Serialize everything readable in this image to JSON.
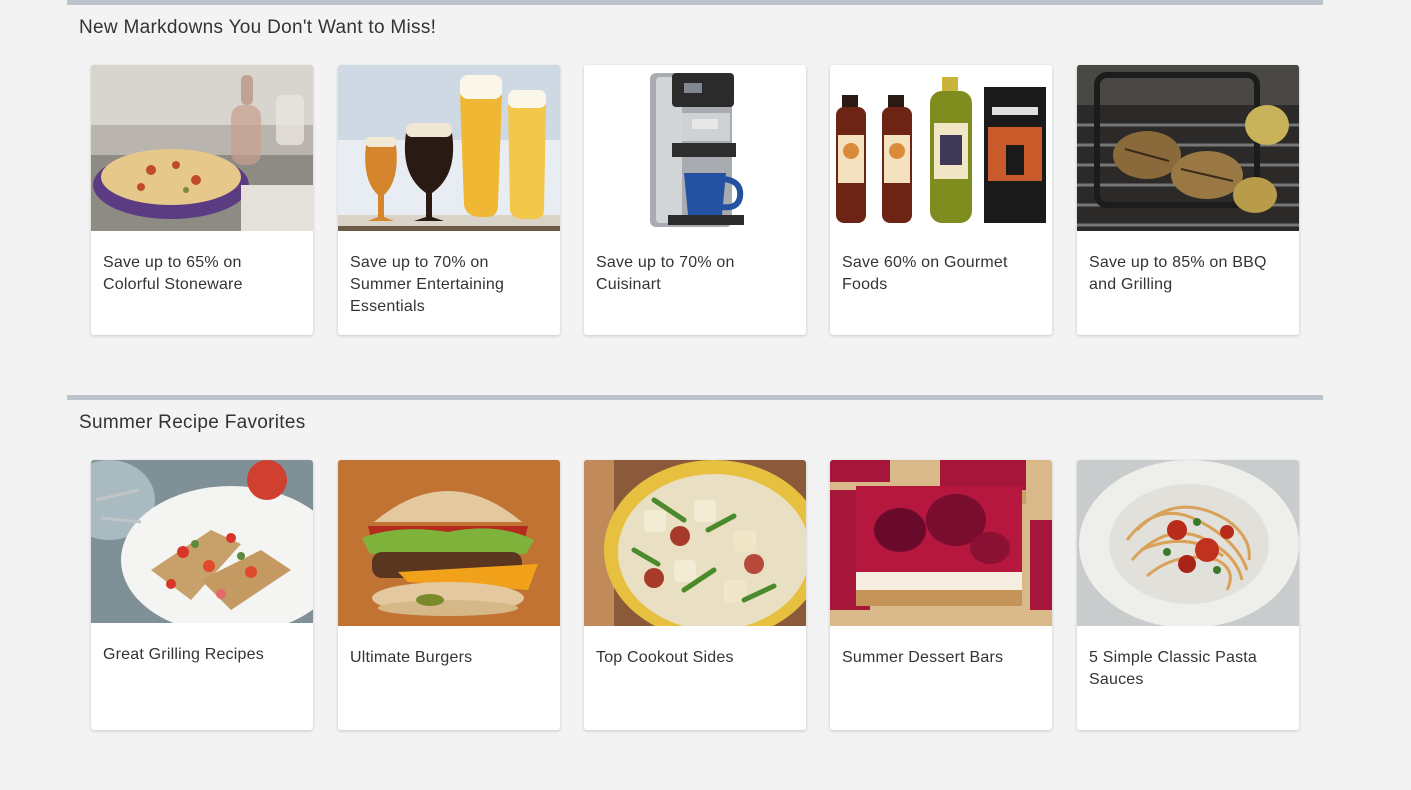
{
  "sections": [
    {
      "title": "New Markdowns You Don't Want to Miss!",
      "cards": [
        {
          "label": "Save up to 65% on Colorful Stoneware",
          "image": "stoneware-casserole-photo"
        },
        {
          "label": "Save up to 70% on Summer Entertaining Essentials",
          "image": "beer-glasses-photo"
        },
        {
          "label": "Save up to 70% on Cuisinart",
          "image": "coffee-maker-photo"
        },
        {
          "label": "Save 60% on Gourmet Foods",
          "image": "gourmet-sauces-photo"
        },
        {
          "label": "Save up to 85% on BBQ and Grilling",
          "image": "grill-basket-photo"
        }
      ]
    },
    {
      "title": "Summer Recipe Favorites",
      "cards": [
        {
          "label": "Great Grilling Recipes",
          "image": "grilled-salad-photo"
        },
        {
          "label": "Ultimate Burgers",
          "image": "burger-photo"
        },
        {
          "label": "Top Cookout Sides",
          "image": "potato-salad-photo"
        },
        {
          "label": "Summer Dessert Bars",
          "image": "dessert-bars-photo"
        },
        {
          "label": "5 Simple Classic Pasta Sauces",
          "image": "pasta-photo"
        }
      ]
    }
  ]
}
